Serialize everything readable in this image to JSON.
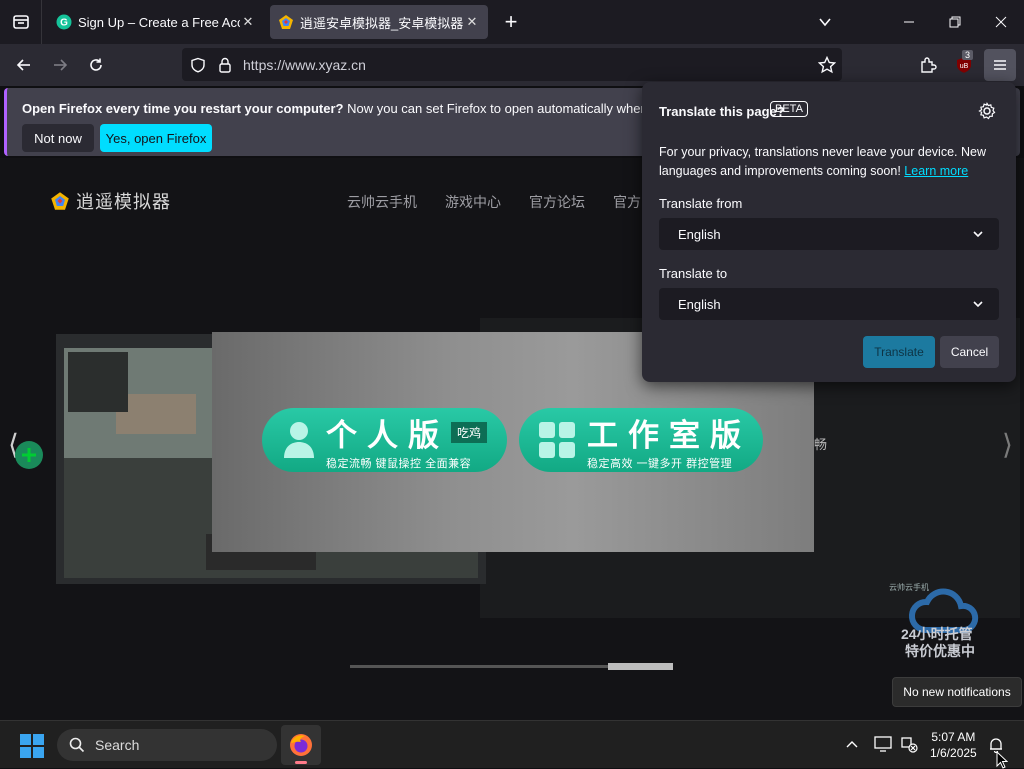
{
  "browser": {
    "tabs": [
      {
        "title": "Sign Up – Create a Free Account",
        "close": "✕"
      },
      {
        "title": "逍遥安卓模拟器_安卓模拟器电脑版",
        "close": "✕"
      }
    ],
    "new_tab": "+",
    "url": "https://www.xyaz.cn",
    "extension_badge": "3"
  },
  "notification": {
    "bold": "Open Firefox every time you restart your computer?",
    "text": " Now you can set Firefox to open automatically when you resta",
    "not_now": "Not now",
    "yes": "Yes, open Firefox"
  },
  "site": {
    "logo": "逍遥模拟器",
    "nav": [
      "云帅云手机",
      "游戏中心",
      "官方论坛",
      "官方"
    ],
    "modal": {
      "personal": {
        "title": "个人版",
        "tag": "吃鸡",
        "sub": "稳定流畅 键鼠操控 全面兼容"
      },
      "studio": {
        "title": "工作室版",
        "sub": "稳定高效 一键多开 群控管理"
      }
    },
    "side_text": "畅",
    "badge": {
      "small": "云帅云手机",
      "line1": "24小时托管",
      "line2": "特价优惠中"
    }
  },
  "translate_panel": {
    "title": "Translate this page?",
    "beta": "BETA",
    "desc": "For your privacy, translations never leave your device. New languages and improvements coming soon!",
    "learn_more": "Learn more",
    "from_label": "Translate from",
    "from_value": "English",
    "to_label": "Translate to",
    "to_value": "English",
    "translate": "Translate",
    "cancel": "Cancel"
  },
  "taskbar": {
    "search": "Search",
    "time": "5:07 AM",
    "date": "1/6/2025",
    "tooltip": "No new notifications"
  }
}
